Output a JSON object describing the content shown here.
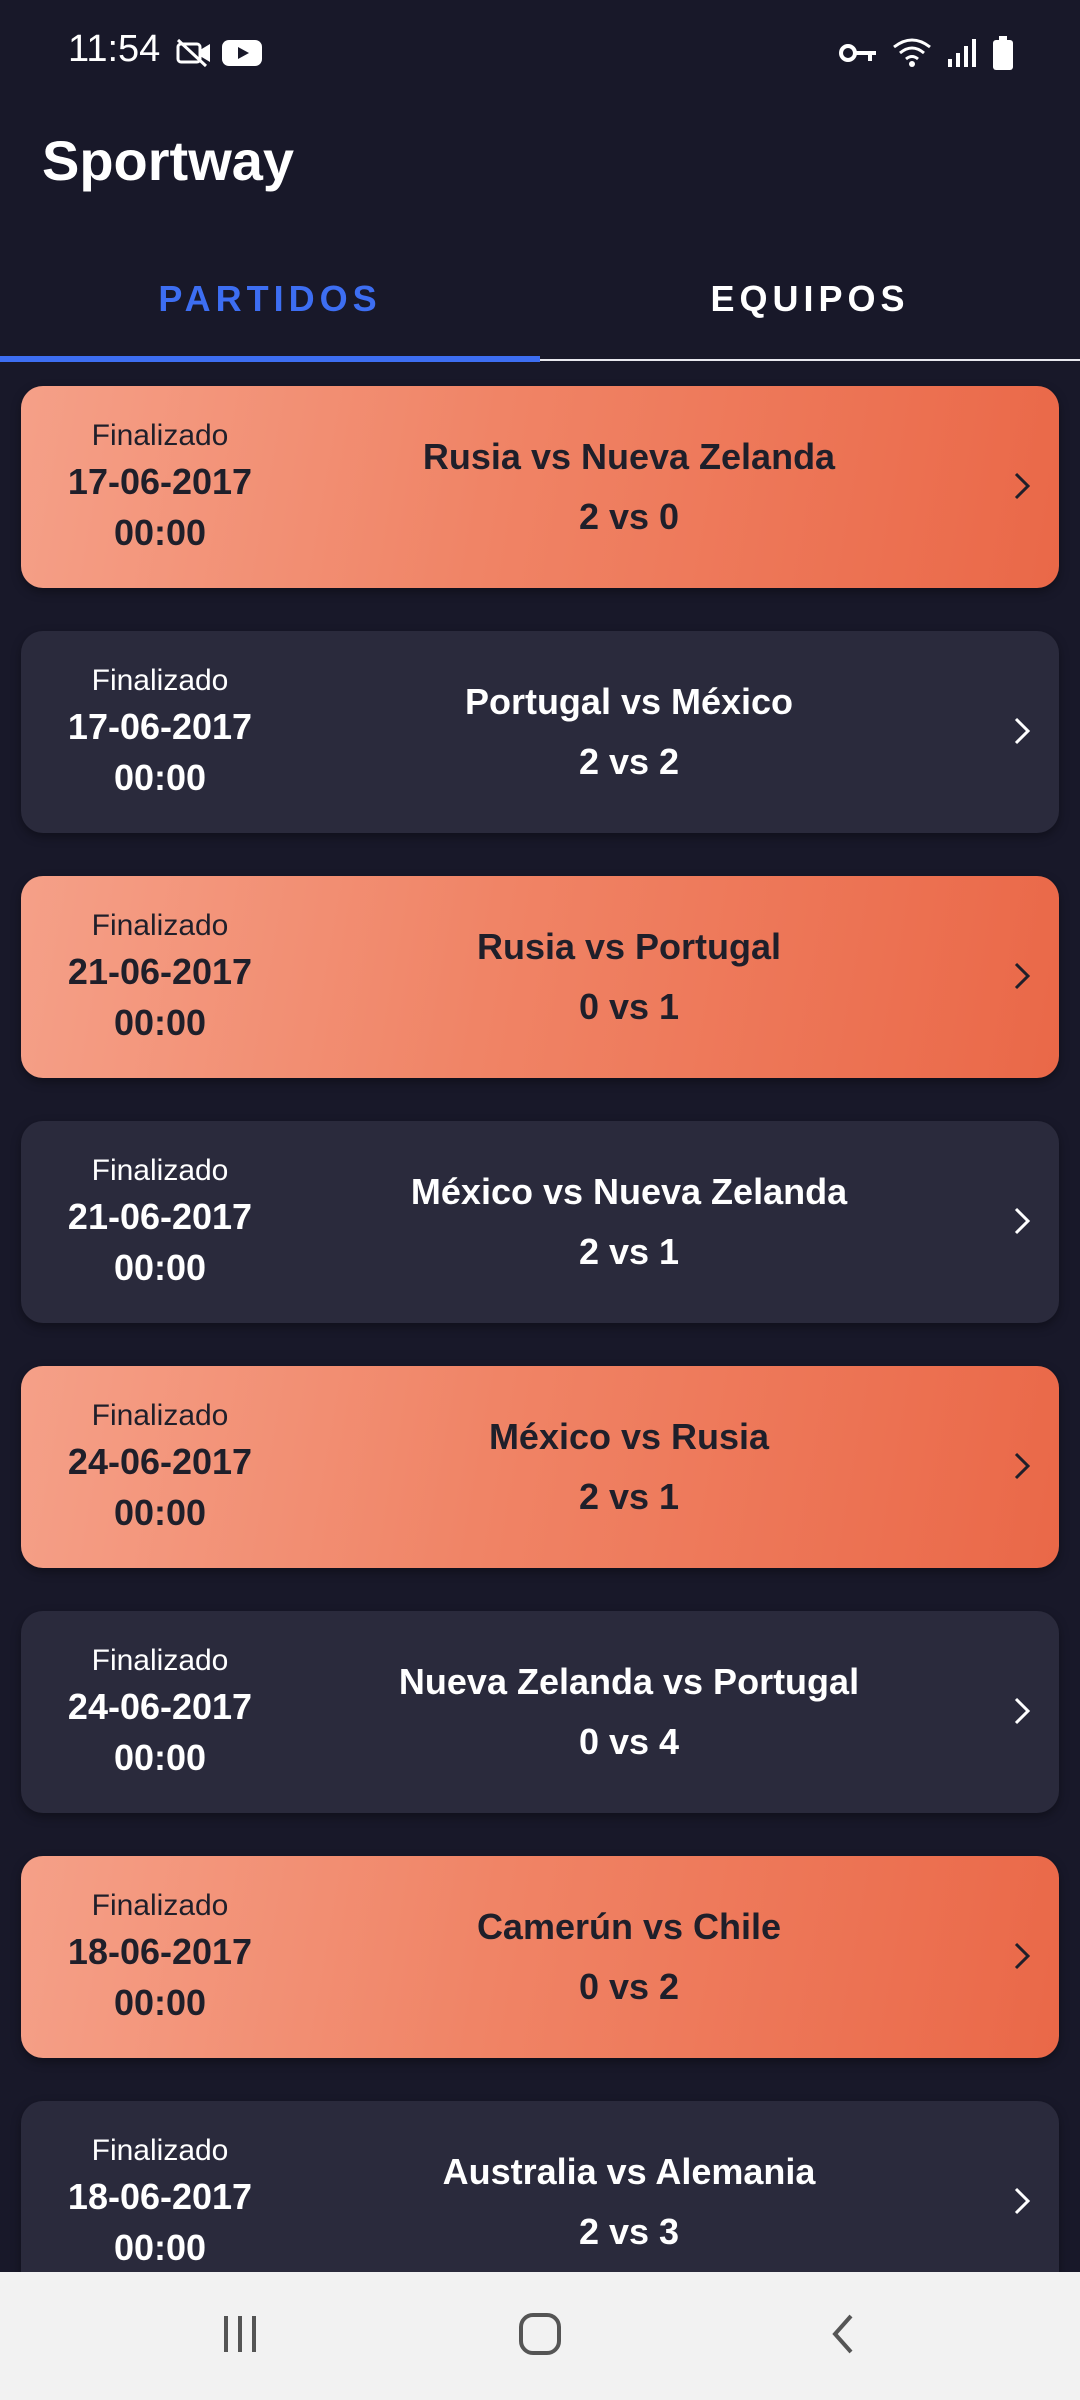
{
  "status_bar": {
    "time": "11:54",
    "left_icons": [
      "camera-off-icon",
      "youtube-icon"
    ],
    "right_icons": [
      "vpn-key-icon",
      "wifi-icon",
      "signal-icon",
      "battery-icon"
    ]
  },
  "app": {
    "title": "Sportway"
  },
  "tabs": [
    {
      "label": "PARTIDOS",
      "selected": true
    },
    {
      "label": "EQUIPOS",
      "selected": false
    }
  ],
  "colors": {
    "accent": "#3d6ef2",
    "background": "#181829",
    "card_dark": "#2a2a3c",
    "card_orange_start": "#f5a088",
    "card_orange_end": "#ea6848"
  },
  "matches": [
    {
      "status": "Finalizado",
      "date": "17-06-2017",
      "time": "00:00",
      "teams": "Rusia vs Nueva Zelanda",
      "score": "2 vs 0",
      "style": "orange"
    },
    {
      "status": "Finalizado",
      "date": "17-06-2017",
      "time": "00:00",
      "teams": "Portugal vs México",
      "score": "2 vs 2",
      "style": "dark"
    },
    {
      "status": "Finalizado",
      "date": "21-06-2017",
      "time": "00:00",
      "teams": "Rusia vs Portugal",
      "score": "0 vs 1",
      "style": "orange"
    },
    {
      "status": "Finalizado",
      "date": "21-06-2017",
      "time": "00:00",
      "teams": "México vs Nueva Zelanda",
      "score": "2 vs 1",
      "style": "dark"
    },
    {
      "status": "Finalizado",
      "date": "24-06-2017",
      "time": "00:00",
      "teams": "México vs Rusia",
      "score": "2 vs 1",
      "style": "orange"
    },
    {
      "status": "Finalizado",
      "date": "24-06-2017",
      "time": "00:00",
      "teams": "Nueva Zelanda vs Portugal",
      "score": "0 vs 4",
      "style": "dark"
    },
    {
      "status": "Finalizado",
      "date": "18-06-2017",
      "time": "00:00",
      "teams": "Camerún vs Chile",
      "score": "0 vs 2",
      "style": "orange"
    },
    {
      "status": "Finalizado",
      "date": "18-06-2017",
      "time": "00:00",
      "teams": "Australia vs Alemania",
      "score": "2 vs 3",
      "style": "dark"
    }
  ],
  "nav_bar": {
    "buttons": [
      "recent-apps-icon",
      "home-icon",
      "back-icon"
    ]
  }
}
